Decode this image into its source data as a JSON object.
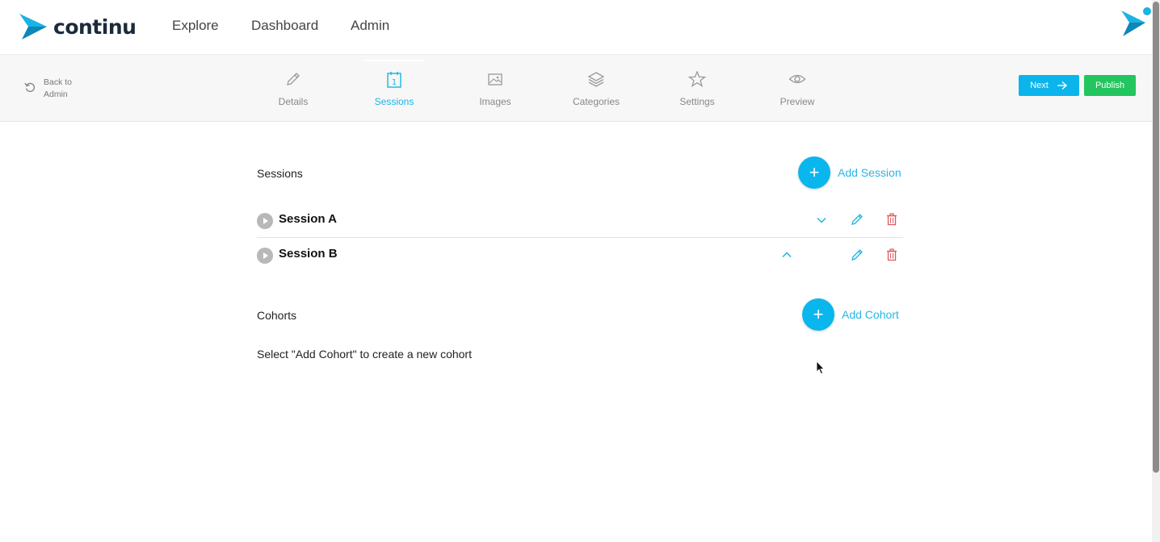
{
  "brand": {
    "name": "continu",
    "primary_color": "#1ab3e6",
    "dark_color": "#1c2b3a"
  },
  "nav": {
    "links": [
      "Explore",
      "Dashboard",
      "Admin"
    ]
  },
  "toolbar": {
    "back_label": "Back to Admin",
    "tabs": [
      {
        "label": "Details",
        "icon": "pencil-icon",
        "active": false
      },
      {
        "label": "Sessions",
        "icon": "calendar-icon",
        "active": true
      },
      {
        "label": "Images",
        "icon": "image-icon",
        "active": false
      },
      {
        "label": "Categories",
        "icon": "layers-icon",
        "active": false
      },
      {
        "label": "Settings",
        "icon": "star-icon",
        "active": false
      },
      {
        "label": "Preview",
        "icon": "eye-icon",
        "active": false
      }
    ],
    "calendar_day": "1",
    "next_label": "Next",
    "publish_label": "Publish",
    "next_color": "#0cb4ec",
    "publish_color": "#22c55e"
  },
  "sessions": {
    "title": "Sessions",
    "add_label": "Add Session",
    "add_symbol": "+",
    "items": [
      {
        "name": "Session A",
        "toggle": "chevron-down-icon"
      },
      {
        "name": "Session B",
        "toggle": "chevron-up-icon"
      }
    ]
  },
  "cohorts": {
    "title": "Cohorts",
    "add_label": "Add Cohort",
    "add_symbol": "+",
    "empty_hint": "Select \"Add Cohort\" to create a new cohort"
  },
  "colors": {
    "edit_icon": "#1ab3e6",
    "delete_icon": "#e05a5a"
  }
}
